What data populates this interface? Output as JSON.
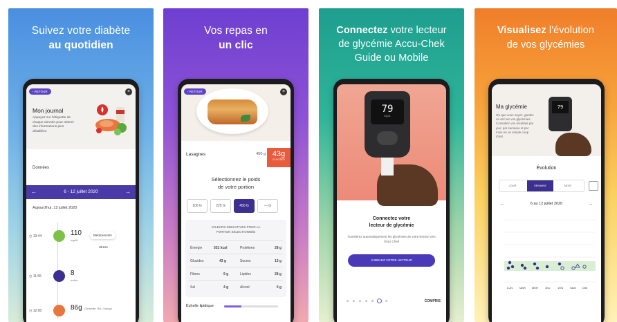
{
  "panels": [
    {
      "headline_pre": "Suivez votre diabète",
      "headline_bold": "au quotidien",
      "back": "‹ RETOUR",
      "journal_title": "Mon journal",
      "journal_desc": "Appuyez sur l'étiquette de chaque donnée pour obtenir des informations plus détaillées",
      "donnees": "Données",
      "date_range": "6 - 12 juillet 2020",
      "today": "Aujourd'hui, 12 juillet 2020",
      "entries": [
        {
          "time": "13:44",
          "value": "110",
          "unit": "mg/dL",
          "tags": [
            "Médicaments",
            "Stress"
          ]
        },
        {
          "time": "11:55",
          "value": "8",
          "unit": "unités"
        },
        {
          "time": "12:00",
          "value": "86g",
          "unit": "Omelette, Riz, Orange"
        }
      ]
    },
    {
      "headline_line1": "Vos repas en",
      "headline_bold": "un clic",
      "back": "‹ RETOUR",
      "food_name": "Lasagnes",
      "food_grams": "450 g",
      "gluc_value": "43g",
      "gluc_label": "GLUCIDES",
      "select_title_1": "Sélectionnez le poids",
      "select_title_2": "de votre portion",
      "portions": [
        "100 G",
        "225 G",
        "450 G",
        "--- G"
      ],
      "nutri_head_1": "VALEURS INDICATIVES POUR LA",
      "nutri_head_2": "PORTION SÉLECTIONNÉE",
      "nutri_rows": [
        [
          "Énergie",
          "531 kcal",
          "Protéines",
          "28 g"
        ],
        [
          "Glucides",
          "43 g",
          "Sucres",
          "13 g"
        ],
        [
          "Fibres",
          "9 g",
          "Lipides",
          "28 g"
        ],
        [
          "Sel",
          "4 g",
          "Alcool",
          "0 g"
        ]
      ],
      "scale_label": "Échelle lipidique",
      "scale_fraction": 0.32
    },
    {
      "headline_bold": "Connectez",
      "headline_rest1": "votre lecteur",
      "headline_line2": "de glycémie Accu-Chek",
      "headline_line3": "Guide ou Mobile",
      "meter_value": "79",
      "meter_unit": "mg/dL",
      "connect_title_1": "Connectez votre",
      "connect_title_2": "lecteur de glycémie",
      "connect_desc": "Transférez automatiquement les glycémies de votre lecteur vers Gluci Chek",
      "button": "JUMELEZ VOTRE LECTEUR",
      "compris": "COMPRIS"
    },
    {
      "headline_bold": "Visualisez",
      "headline_rest": "l'évolution",
      "headline_line2": "de vos glycémies",
      "g_title": "Ma glycémie",
      "g_desc": "Où que vous soyez, gardez un œil sur vos glycémies. Consultez vos résultats par jour, par semaine et par mois en un simple coup d'œil.",
      "meter_value": "79",
      "evolution": "Évolution",
      "tabs": [
        "JOUR",
        "SEMAINE",
        "MOIS"
      ],
      "week": "6 au 12 juillet 2020",
      "days": [
        "LUN",
        "MAR",
        "MER",
        "JEU",
        "VEN",
        "SAM",
        "DIM"
      ]
    }
  ],
  "colors": {
    "accent": "#3b2f8f",
    "orange": "#e85b3d"
  }
}
